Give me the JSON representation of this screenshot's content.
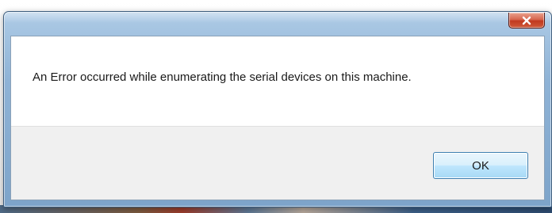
{
  "dialog": {
    "message": "An Error occurred while enumerating the serial devices on this machine.",
    "ok_label": "OK",
    "close_icon": "close-x-icon"
  },
  "colors": {
    "title_bar": "#8fb3d6",
    "close_button": "#c1391f",
    "button_area": "#f0f0f0",
    "ok_button_border": "#3c7fb1"
  }
}
